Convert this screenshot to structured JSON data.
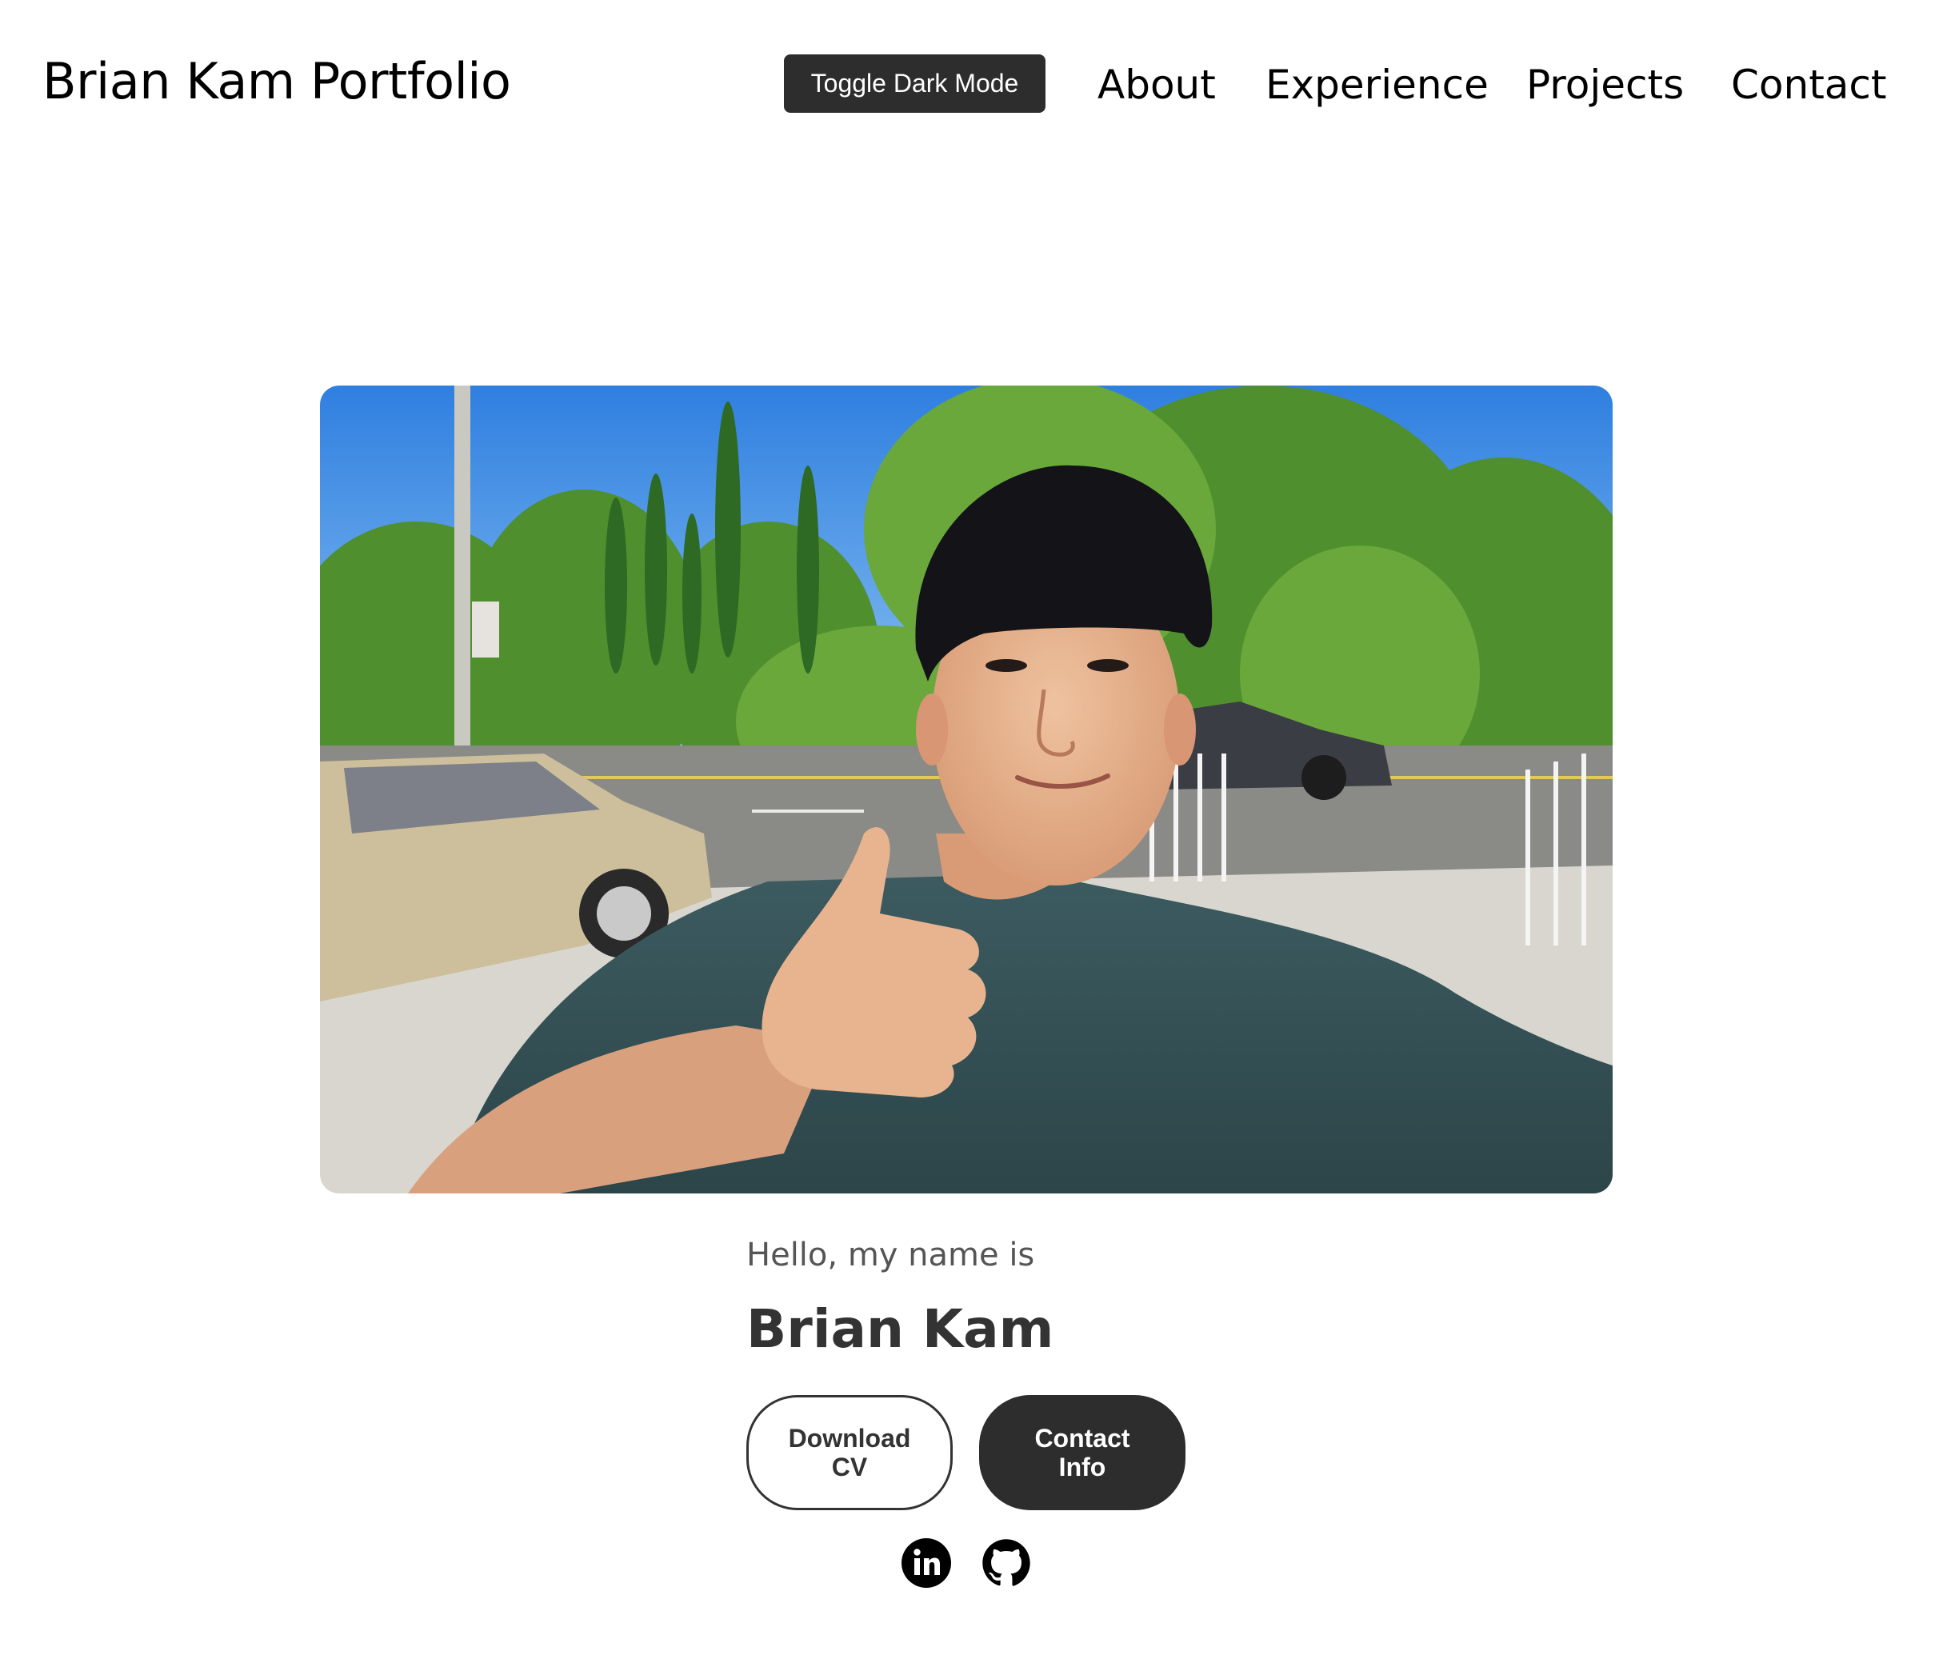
{
  "header": {
    "brand": "Brian Kam Portfolio",
    "toggle_label": "Toggle Dark Mode",
    "nav": [
      {
        "label": "About"
      },
      {
        "label": "Experience"
      },
      {
        "label": "Projects"
      },
      {
        "label": "Contact"
      }
    ]
  },
  "hero": {
    "photo_icon": "profile-photo",
    "greeting": "Hello, my name is",
    "name": "Brian Kam",
    "buttons": {
      "download_cv": "Download CV",
      "contact_info": "Contact Info"
    },
    "social": [
      {
        "icon": "linkedin-icon"
      },
      {
        "icon": "github-icon"
      }
    ]
  },
  "colors": {
    "dark_button": "#2d2d2d",
    "text_dark": "#333333",
    "text_muted": "#555555",
    "background": "#ffffff"
  }
}
